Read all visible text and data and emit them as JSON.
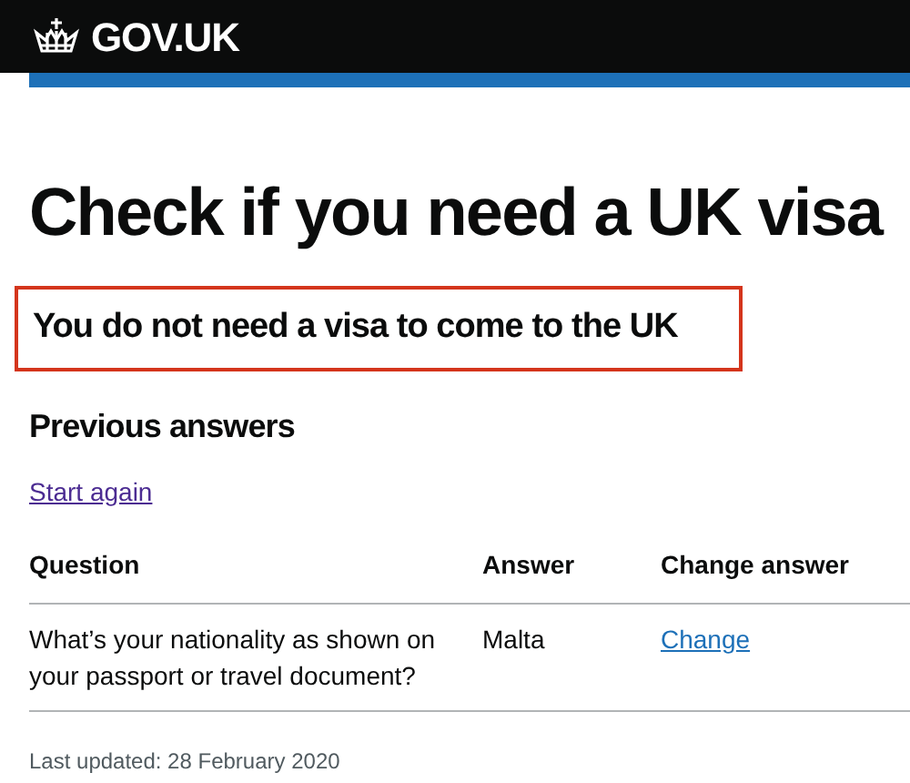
{
  "header": {
    "logo": "GOV.UK"
  },
  "title": "Check if you need a UK visa",
  "result": "You do not need a visa to come to the UK",
  "previous_answers": {
    "heading": "Previous answers",
    "start_again": "Start again"
  },
  "table": {
    "columns": [
      "Question",
      "Answer",
      "Change answer"
    ],
    "rows": [
      {
        "question": "What’s your nationality as shown on your passport or travel document?",
        "answer": "Malta",
        "change": "Change"
      }
    ]
  },
  "last_updated": "Last updated: 28 February 2020"
}
